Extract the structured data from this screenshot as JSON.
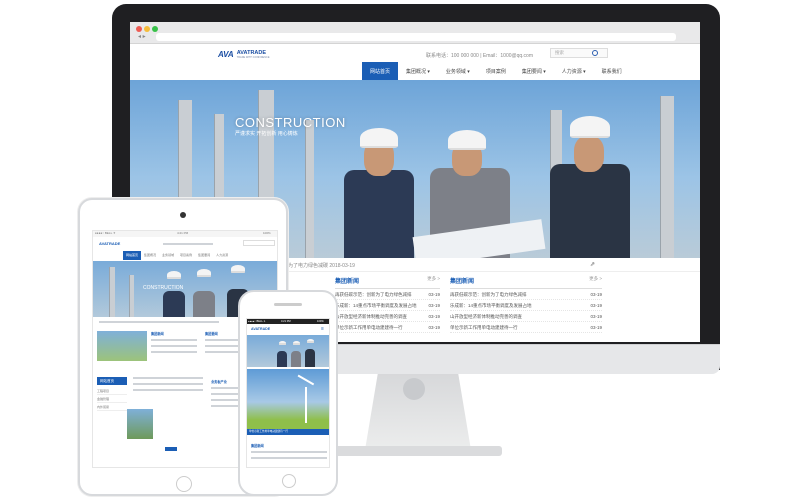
{
  "desktop": {
    "logo_mark": "AVA",
    "logo_name": "AVATRADE",
    "logo_tag": "TRADE WITH CONFIDENCE",
    "contact": "联系电话：100 000 000  |  Email：1000@qq.com",
    "search_placeholder": "搜索",
    "nav": [
      {
        "label": "网站首页",
        "active": true
      },
      {
        "label": "集团概况 ▾"
      },
      {
        "label": "业务领域 ▾"
      },
      {
        "label": "项目案例"
      },
      {
        "label": "集团要闻 ▾"
      },
      {
        "label": "人力资源 ▾"
      },
      {
        "label": "联系我们"
      }
    ],
    "hero_title": "CONSTRUCTION",
    "hero_sub": "严谨求实 开拓创新 用心铸炼",
    "strip_text": "为了电力绿色减碳      2018-03-19",
    "news_left": {
      "title": "集团新闻",
      "more": "更多 >",
      "items": [
        {
          "text": "再获低碳示范：创新为了电力绿色减排",
          "date": "03-19"
        },
        {
          "text": "乐成新：14重点市场平衡调度及发展占地",
          "date": "03-19"
        },
        {
          "text": "山开放型经济新体制推动完善的调查",
          "date": "03-19"
        },
        {
          "text": "单位示新工作用单电动建建待一行",
          "date": "03-19"
        }
      ]
    },
    "news_right": {
      "title": "集团新闻",
      "more": "更多 >",
      "items": [
        {
          "text": "再获低碳示范：创新为了电力绿色减排",
          "date": "03-19"
        },
        {
          "text": "乐成新：14重点市场平衡调度及发展占地",
          "date": "03-19"
        },
        {
          "text": "山开放型经济新体制推动完善的调查",
          "date": "03-19"
        },
        {
          "text": "单位示新工作用单电动建建待一行",
          "date": "03-19"
        }
      ]
    }
  },
  "tablet": {
    "status_carrier": "●●●●○ BELL ✈",
    "status_time": "4:21 PM",
    "status_batt": "100%",
    "logo": "AVATRADE",
    "nav": [
      "网站首页",
      "集团概况",
      "业务领域",
      "项目案例",
      "集团要闻",
      "人力资源"
    ],
    "hero_title": "CONSTRUCTION",
    "section_a": "集团新闻",
    "section_b": "集团要闻",
    "section_c": "网站首页",
    "section_d": "业务板产业",
    "side_items": [
      "工程项目",
      "金融管理",
      "内外贸易"
    ]
  },
  "phone": {
    "status_carrier": "●●●●○ BELL ✈",
    "status_time": "4:21 PM",
    "status_batt": "100%",
    "logo": "AVATRADE",
    "caption": "单位示新工作用单电动建建待一行",
    "section": "集团新闻"
  },
  "colors": {
    "brand": "#1b5eb5",
    "bezel": "#1f1f22"
  }
}
